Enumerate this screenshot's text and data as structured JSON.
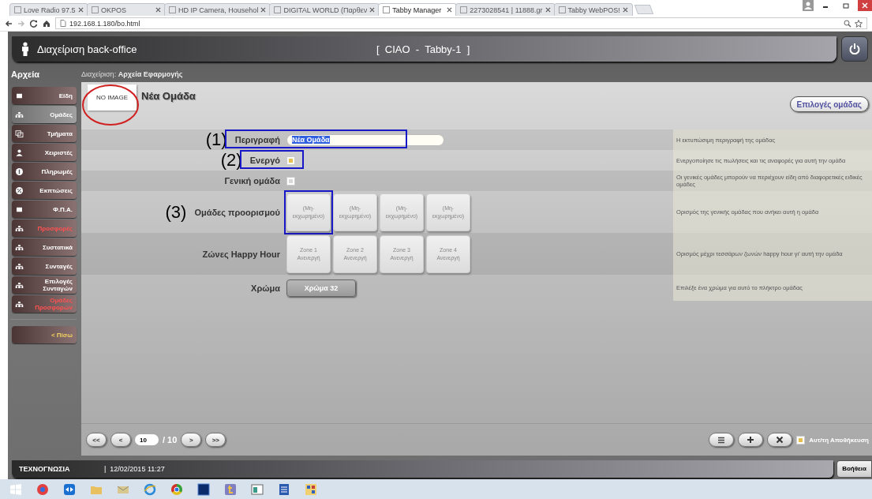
{
  "browser": {
    "tabs": [
      {
        "title": "Love Radio 97.5",
        "selected": false
      },
      {
        "title": "OKPOS",
        "selected": false
      },
      {
        "title": "HD IP Camera, Househol",
        "selected": false
      },
      {
        "title": "DIGITAL WORLD (Παρθεν",
        "selected": false
      },
      {
        "title": "Tabby Manager",
        "selected": true
      },
      {
        "title": "2273028541 | 11888.gr",
        "selected": false
      },
      {
        "title": "Tabby WebPOS!",
        "selected": false
      }
    ],
    "address": "192.168.1.180/bo.html"
  },
  "header": {
    "title": "Διαχείριση back-office",
    "station": "[  CIAO  -  Tabby-1  ]"
  },
  "sidebar": {
    "heading": "Αρχεία",
    "items": [
      {
        "label": "Είδη",
        "selected": false,
        "highlighted": false
      },
      {
        "label": "Ομάδες",
        "selected": true,
        "highlighted": false
      },
      {
        "label": "Τμήματα",
        "selected": false,
        "highlighted": false
      },
      {
        "label": "Χειριστές",
        "selected": false,
        "highlighted": false
      },
      {
        "label": "Πληρωμές",
        "selected": false,
        "highlighted": false
      },
      {
        "label": "Εκπτώσεις",
        "selected": false,
        "highlighted": false
      },
      {
        "label": "Φ.Π.Α.",
        "selected": false,
        "highlighted": false
      },
      {
        "label": "Προσφορές",
        "selected": false,
        "highlighted": true
      },
      {
        "label": "Συστατικά",
        "selected": false,
        "highlighted": false
      },
      {
        "label": "Συνταγές",
        "selected": false,
        "highlighted": false
      },
      {
        "label": "Επιλογές Συνταγών",
        "selected": false,
        "highlighted": false
      },
      {
        "label": "Ομάδες Προσφορών",
        "selected": false,
        "highlighted": true
      }
    ],
    "back": "< Πίσω"
  },
  "breadcrumb": {
    "prefix": "Διαχείριση:",
    "page": "Αρχεία Εφαρμογής"
  },
  "record": {
    "image": "NO IMAGE",
    "image_circled": true,
    "title": "Νέα Ομάδα",
    "options_button": "Επιλογές ομάδας"
  },
  "fields": [
    {
      "kind": "text",
      "label": "Περιγραφή",
      "value": "Νέα Ομάδα",
      "annotation": "(1)",
      "highlighted": true,
      "description": "Η εκτυπώσιμη περιγραφή της ομάδας"
    },
    {
      "kind": "checkbox",
      "label": "Ενεργό",
      "checked": true,
      "annotation": "(2)",
      "highlighted": true,
      "description": "Ενεργοποίησε τις πωλήσεις και τις αναφορές για αυτή την ομάδα"
    },
    {
      "kind": "checkbox",
      "label": "Γενική ομάδα",
      "checked": false,
      "description": "Οι γενικές ομάδες μπορούν να περιέχουν είδη από διαφορετικές ειδικές ομάδες"
    },
    {
      "kind": "options",
      "label": "Ομάδες προορισμού",
      "annotation": "(3)",
      "options": [
        {
          "label": "(Μη-εκχωρημένο)",
          "highlighted": true
        },
        {
          "label": "(Μη-εκχωρημένο)",
          "highlighted": false
        },
        {
          "label": "(Μη-εκχωρημένο)",
          "highlighted": false
        },
        {
          "label": "(Μη-εκχωρημένο)",
          "highlighted": false
        }
      ],
      "description": "Ορισμός της γενικής ομάδας που ανήκει αυτή η ομάδα"
    },
    {
      "kind": "options",
      "label": "Ζώνες Happy Hour",
      "options": [
        {
          "label": "Zone 1\nΑνενεργή",
          "highlighted": false
        },
        {
          "label": "Zone 2\nΑνενεργή",
          "highlighted": false
        },
        {
          "label": "Zone 3\nΑνενεργή",
          "highlighted": false
        },
        {
          "label": "Zone 4\nΑνενεργή",
          "highlighted": false
        }
      ],
      "description": "Ορισμός μέχρι τεσσάρων ζωνών happy hour γι' αυτή την ομάδα"
    },
    {
      "kind": "color",
      "label": "Χρώμα",
      "value": "Χρώμα 32",
      "description": "Επιλέξε ένα χρώμα για αυτό το πλήκτρο ομάδας"
    }
  ],
  "pager": {
    "first": "<<",
    "prev": "<",
    "page": "10",
    "total": "/ 10",
    "next": ">",
    "last": ">>"
  },
  "autosave": {
    "label": "Αυτ/τη Αποθήκευση",
    "checked": true
  },
  "footer": {
    "company": "ΤΕΧΝΟΓΝΩΣΙΑ",
    "datetime": "|  12/02/2015 11:27",
    "help": "Βοήθεια"
  }
}
